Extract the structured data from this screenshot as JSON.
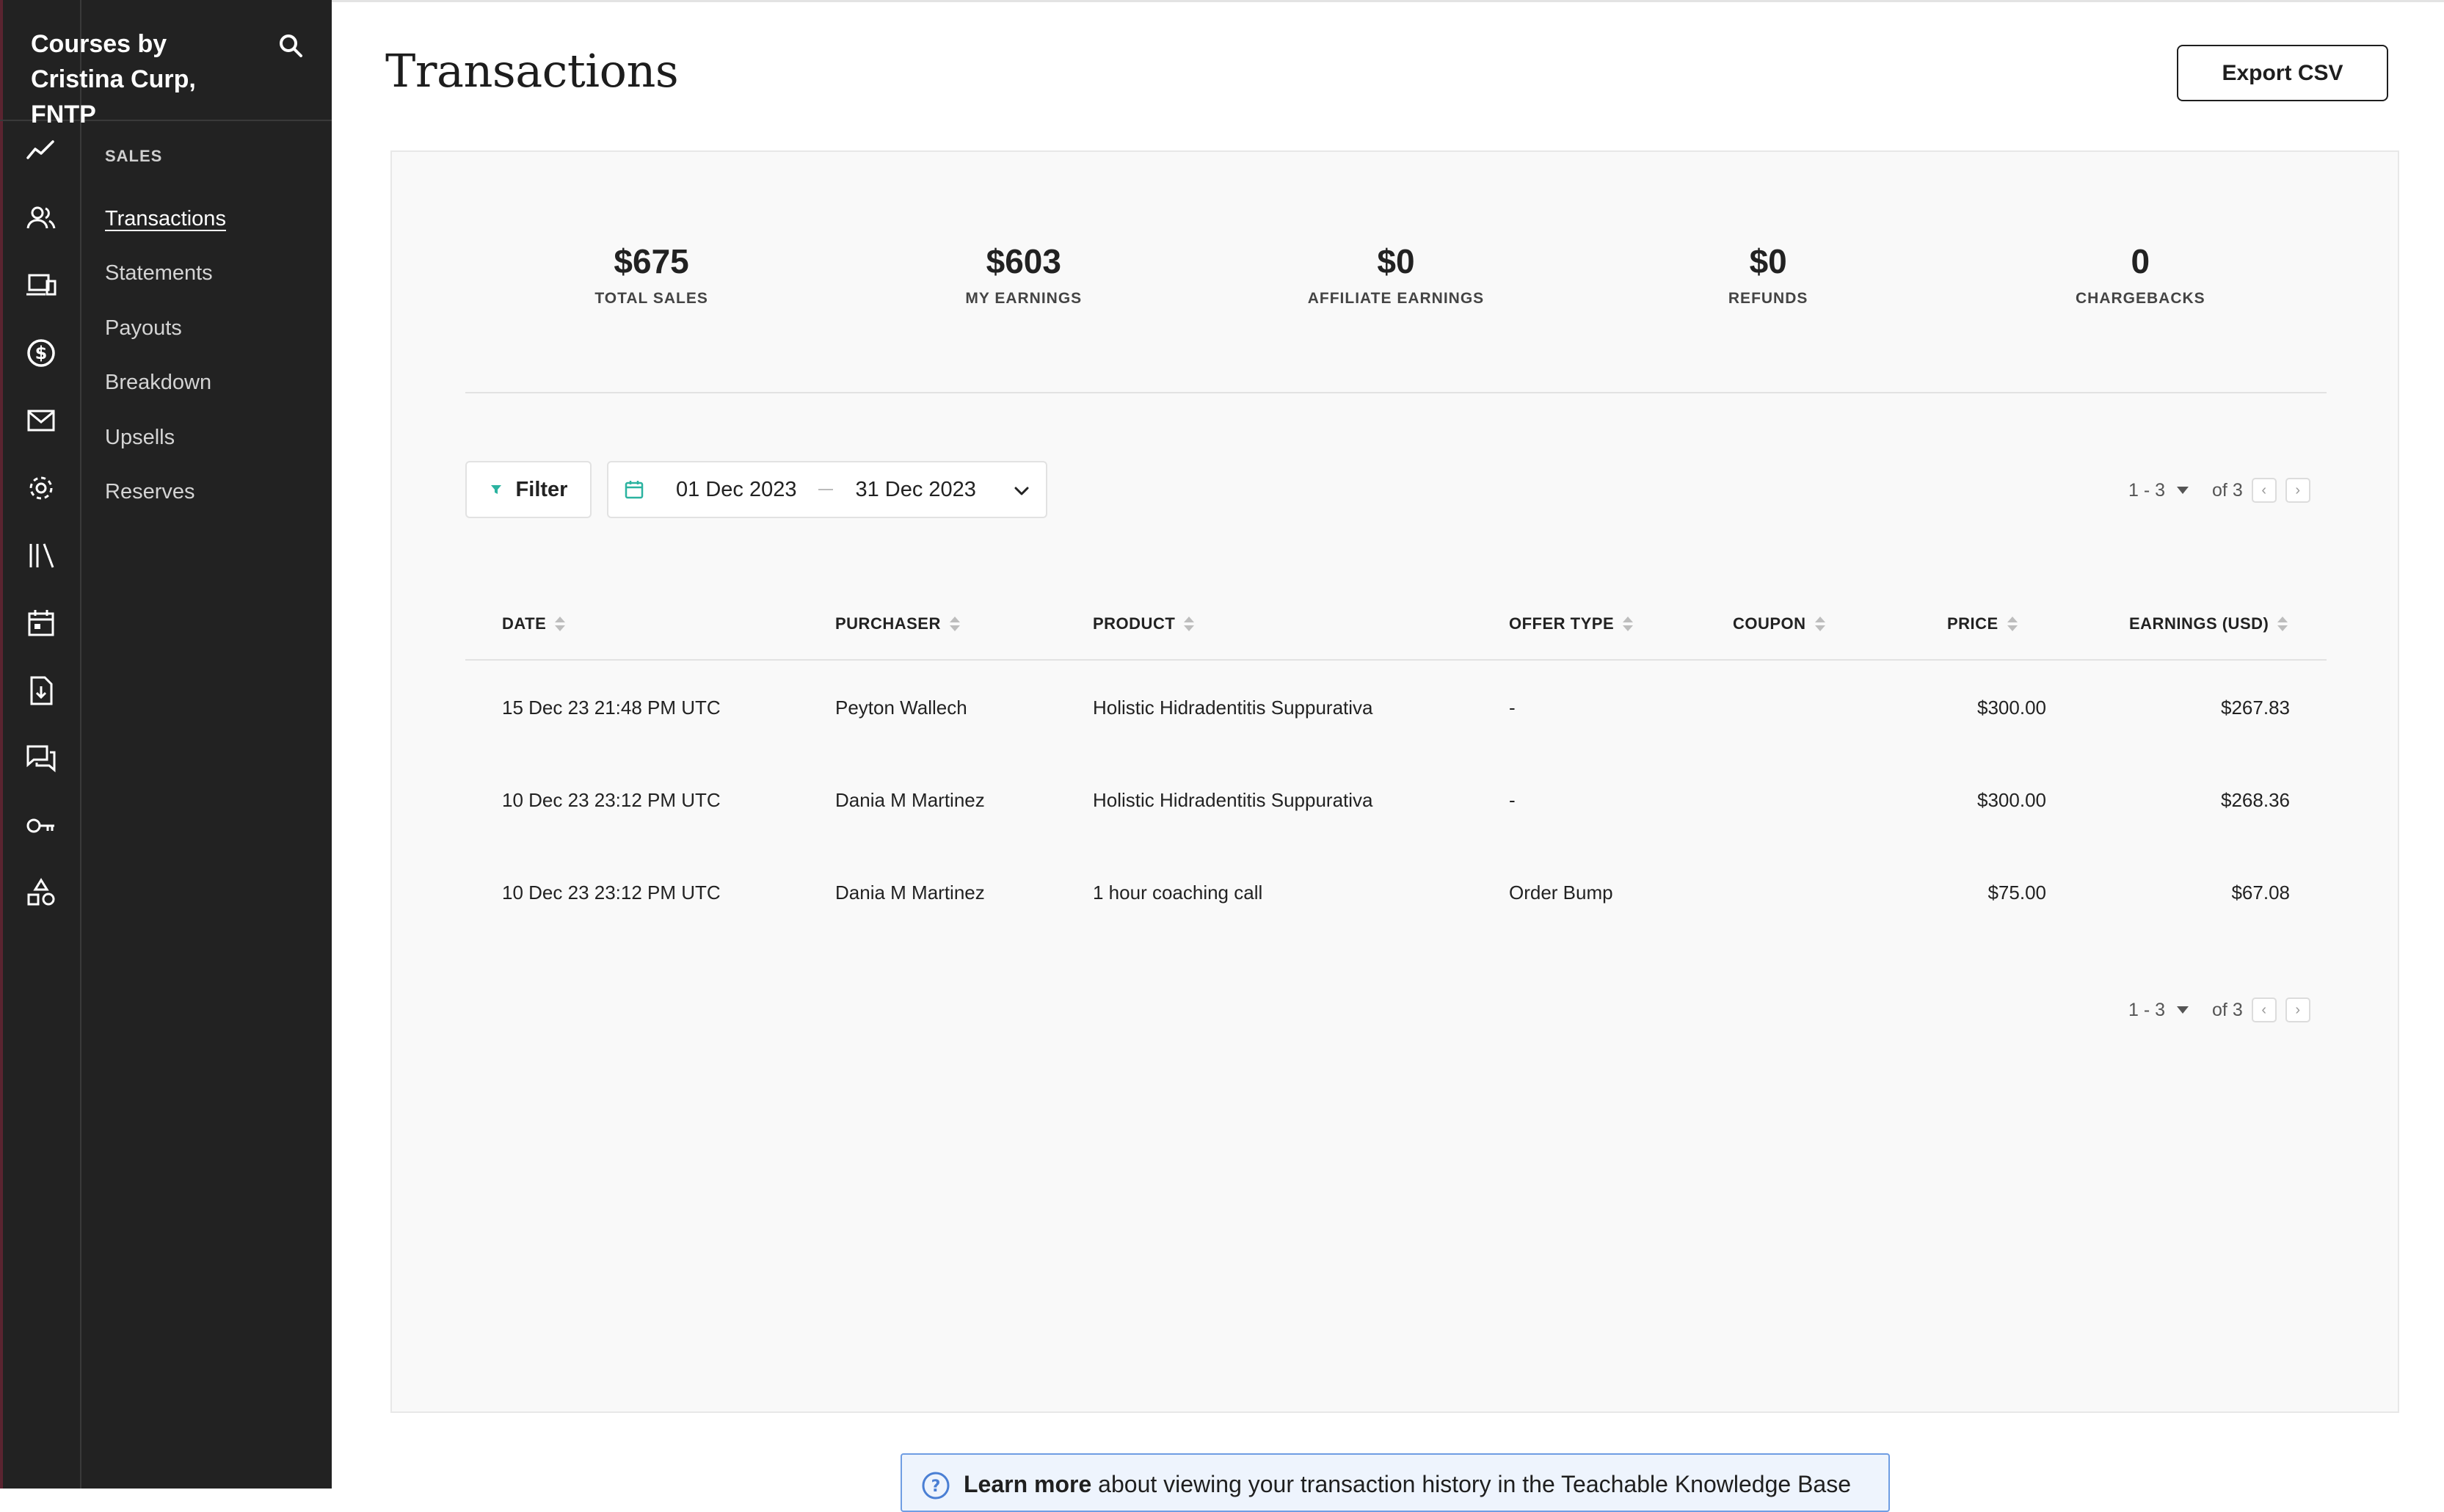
{
  "brand": {
    "name": "Courses by Cristina Curp, FNTP"
  },
  "rail_icons": [
    "analytics-icon",
    "users-icon",
    "devices-icon",
    "dollar-icon",
    "mail-icon",
    "gear-icon",
    "library-icon",
    "calendar-icon",
    "download-doc-icon",
    "comments-icon",
    "key-icon",
    "shapes-icon"
  ],
  "subnav": {
    "section": "SALES",
    "items": [
      {
        "label": "Transactions"
      },
      {
        "label": "Statements"
      },
      {
        "label": "Payouts"
      },
      {
        "label": "Breakdown"
      },
      {
        "label": "Upsells"
      },
      {
        "label": "Reserves"
      }
    ]
  },
  "page": {
    "title": "Transactions",
    "export_label": "Export CSV"
  },
  "stats": [
    {
      "value": "$675",
      "label": "TOTAL SALES"
    },
    {
      "value": "$603",
      "label": "MY EARNINGS"
    },
    {
      "value": "$0",
      "label": "AFFILIATE EARNINGS"
    },
    {
      "value": "$0",
      "label": "REFUNDS"
    },
    {
      "value": "0",
      "label": "CHARGEBACKS"
    }
  ],
  "filters": {
    "filter_label": "Filter",
    "date_from": "01 Dec 2023",
    "date_to": "31 Dec 2023"
  },
  "pager": {
    "range": "1 - 3",
    "total": "of 3"
  },
  "table": {
    "columns": [
      "DATE",
      "PURCHASER",
      "PRODUCT",
      "OFFER TYPE",
      "COUPON",
      "PRICE",
      "EARNINGS (USD)"
    ],
    "rows": [
      [
        "15 Dec 23 21:48 PM UTC",
        "Peyton Wallech",
        "Holistic Hidradentitis Suppurativa",
        "-",
        "",
        "$300.00",
        "$267.83"
      ],
      [
        "10 Dec 23 23:12 PM UTC",
        "Dania M Martinez",
        "Holistic Hidradentitis Suppurativa",
        "-",
        "",
        "$300.00",
        "$268.36"
      ],
      [
        "10 Dec 23 23:12 PM UTC",
        "Dania M Martinez",
        "1 hour coaching call",
        "Order Bump",
        "",
        "$75.00",
        "$67.08"
      ]
    ]
  },
  "banner": {
    "bold": "Learn more",
    "text": " about viewing your transaction history in the Teachable Knowledge Base"
  },
  "colors": {
    "sidebar": "#222222",
    "accent_teal": "#2bb3a0",
    "info_blue": "#6f9de3"
  }
}
